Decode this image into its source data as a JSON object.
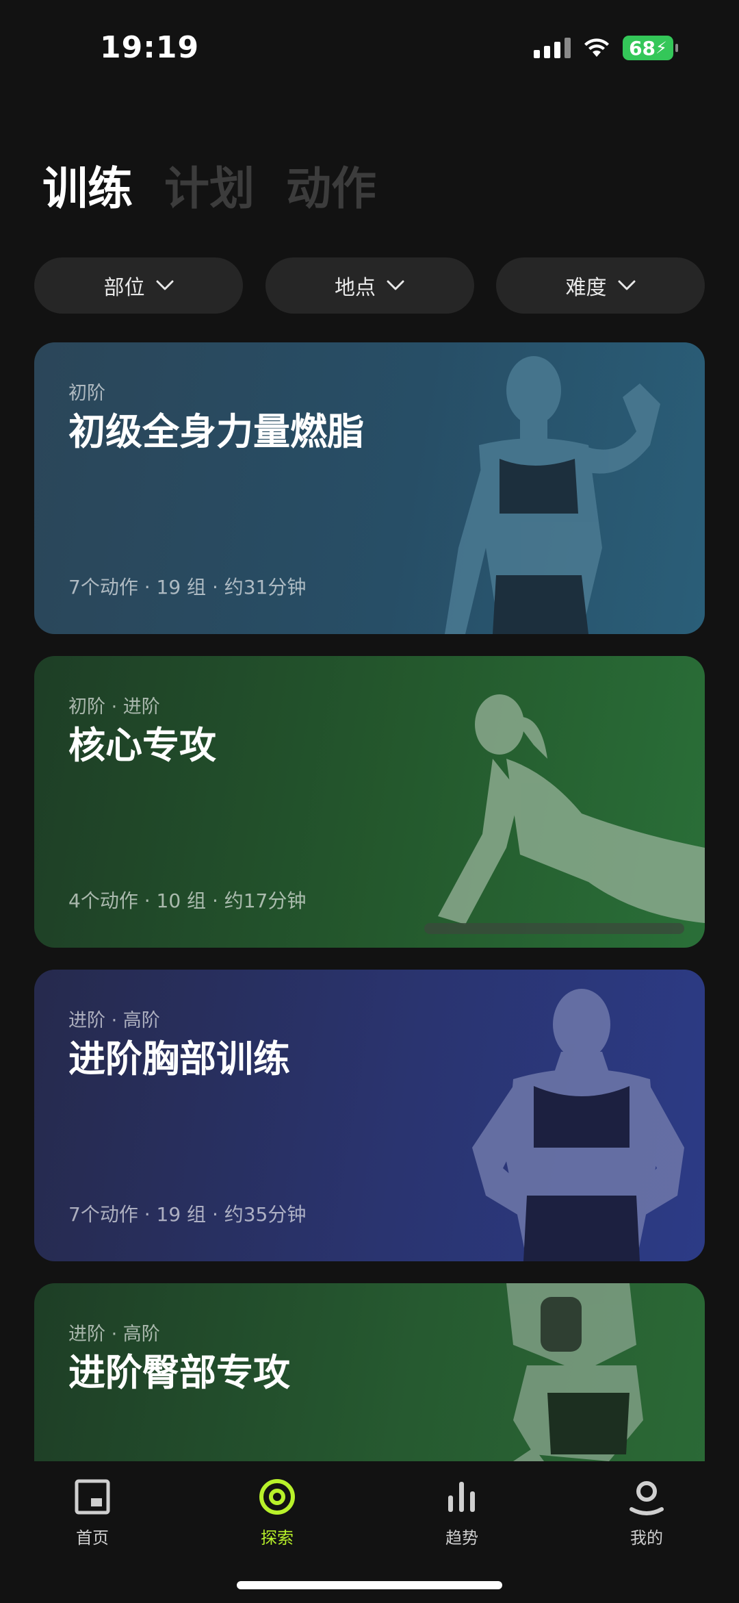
{
  "status_bar": {
    "time": "19:19",
    "battery": "68"
  },
  "top_tabs": [
    {
      "label": "训练",
      "active": true
    },
    {
      "label": "计划",
      "active": false
    },
    {
      "label": "动作",
      "active": false
    }
  ],
  "filters": [
    {
      "label": "部位"
    },
    {
      "label": "地点"
    },
    {
      "label": "难度"
    }
  ],
  "cards": [
    {
      "level": "初阶",
      "title": "初级全身力量燃脂",
      "meta": "7个动作 · 19 组 · 约31分钟",
      "color": "#274e66"
    },
    {
      "level": "初阶 · 进阶",
      "title": "核心专攻",
      "meta": "4个动作 · 10 组 · 约17分钟",
      "color": "#24592d"
    },
    {
      "level": "进阶 · 高阶",
      "title": "进阶胸部训练",
      "meta": "7个动作 · 19 组 · 约35分钟",
      "color": "#2a3470"
    },
    {
      "level": "进阶 · 高阶",
      "title": "进阶臀部专攻",
      "meta": "",
      "color": "#265a30"
    }
  ],
  "bottom_nav": [
    {
      "label": "首页",
      "icon": "home-icon",
      "active": false
    },
    {
      "label": "探索",
      "icon": "explore-icon",
      "active": true
    },
    {
      "label": "趋势",
      "icon": "trends-icon",
      "active": false
    },
    {
      "label": "我的",
      "icon": "profile-icon",
      "active": false
    }
  ],
  "colors": {
    "accent": "#b8f12a",
    "background": "#121212",
    "chip": "#262626"
  }
}
